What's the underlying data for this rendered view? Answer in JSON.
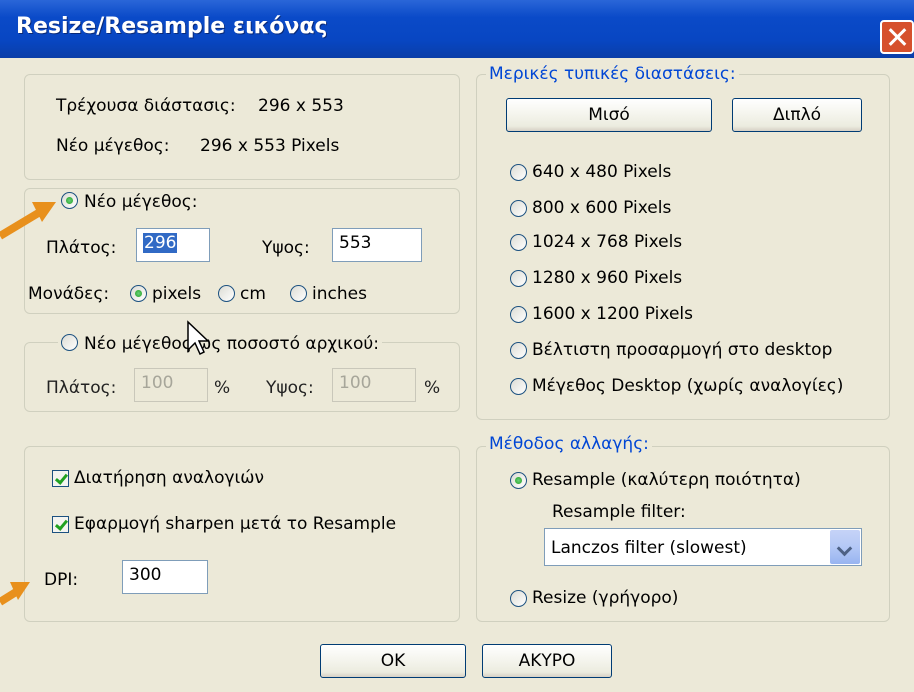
{
  "window": {
    "title": "Resize/Resample εικόνας"
  },
  "info": {
    "current_label": "Τρέχουσα διάστασις:",
    "current_value": "296  x  553",
    "new_label": "Νέο μέγεθος:",
    "new_value": "296  x  553 Pixels"
  },
  "new_size": {
    "title": "Νέο μέγεθος:",
    "width_label": "Πλάτος:",
    "width_value": "296",
    "height_label": "Υψος:",
    "height_value": "553",
    "units_label": "Μονάδες:",
    "unit_pixels": "pixels",
    "unit_cm": "cm",
    "unit_inches": "inches"
  },
  "percent": {
    "title": "Νέο μέγεθος ως ποσοστό αρχικού:",
    "width_label": "Πλάτος:",
    "width_value": "100",
    "height_label": "Υψος:",
    "height_value": "100",
    "percent_sign": "%"
  },
  "options": {
    "keep_ratio": "Διατήρηση αναλογιών",
    "sharpen": "Εφαρμογή sharpen μετά το Resample",
    "dpi_label": "DPI:",
    "dpi_value": "300"
  },
  "presets": {
    "title": "Μερικές τυπικές διαστάσεις:",
    "half_button": "Μισό",
    "double_button": "Διπλό",
    "items": [
      "640 x 480 Pixels",
      "800 x 600 Pixels",
      "1024 x 768 Pixels",
      "1280 x 960 Pixels",
      "1600 x 1200 Pixels",
      "Βέλτιστη προσαρμογή στο desktop",
      "Μέγεθος Desktop (χωρίς αναλογίες)"
    ]
  },
  "method": {
    "title": "Μέθοδος αλλαγής:",
    "resample": "Resample (καλύτερη ποιότητα)",
    "filter_label": "Resample filter:",
    "filter_value": "Lanczos filter (slowest)",
    "resize": "Resize (γρήγορο)"
  },
  "buttons": {
    "ok": "OK",
    "cancel": "ΑΚΥΡΟ"
  },
  "colors": {
    "title_bar": "#0846c2",
    "dialog_bg": "#ece9d8",
    "group_title": "#0046d5",
    "annotation_arrow": "#e8901c"
  }
}
